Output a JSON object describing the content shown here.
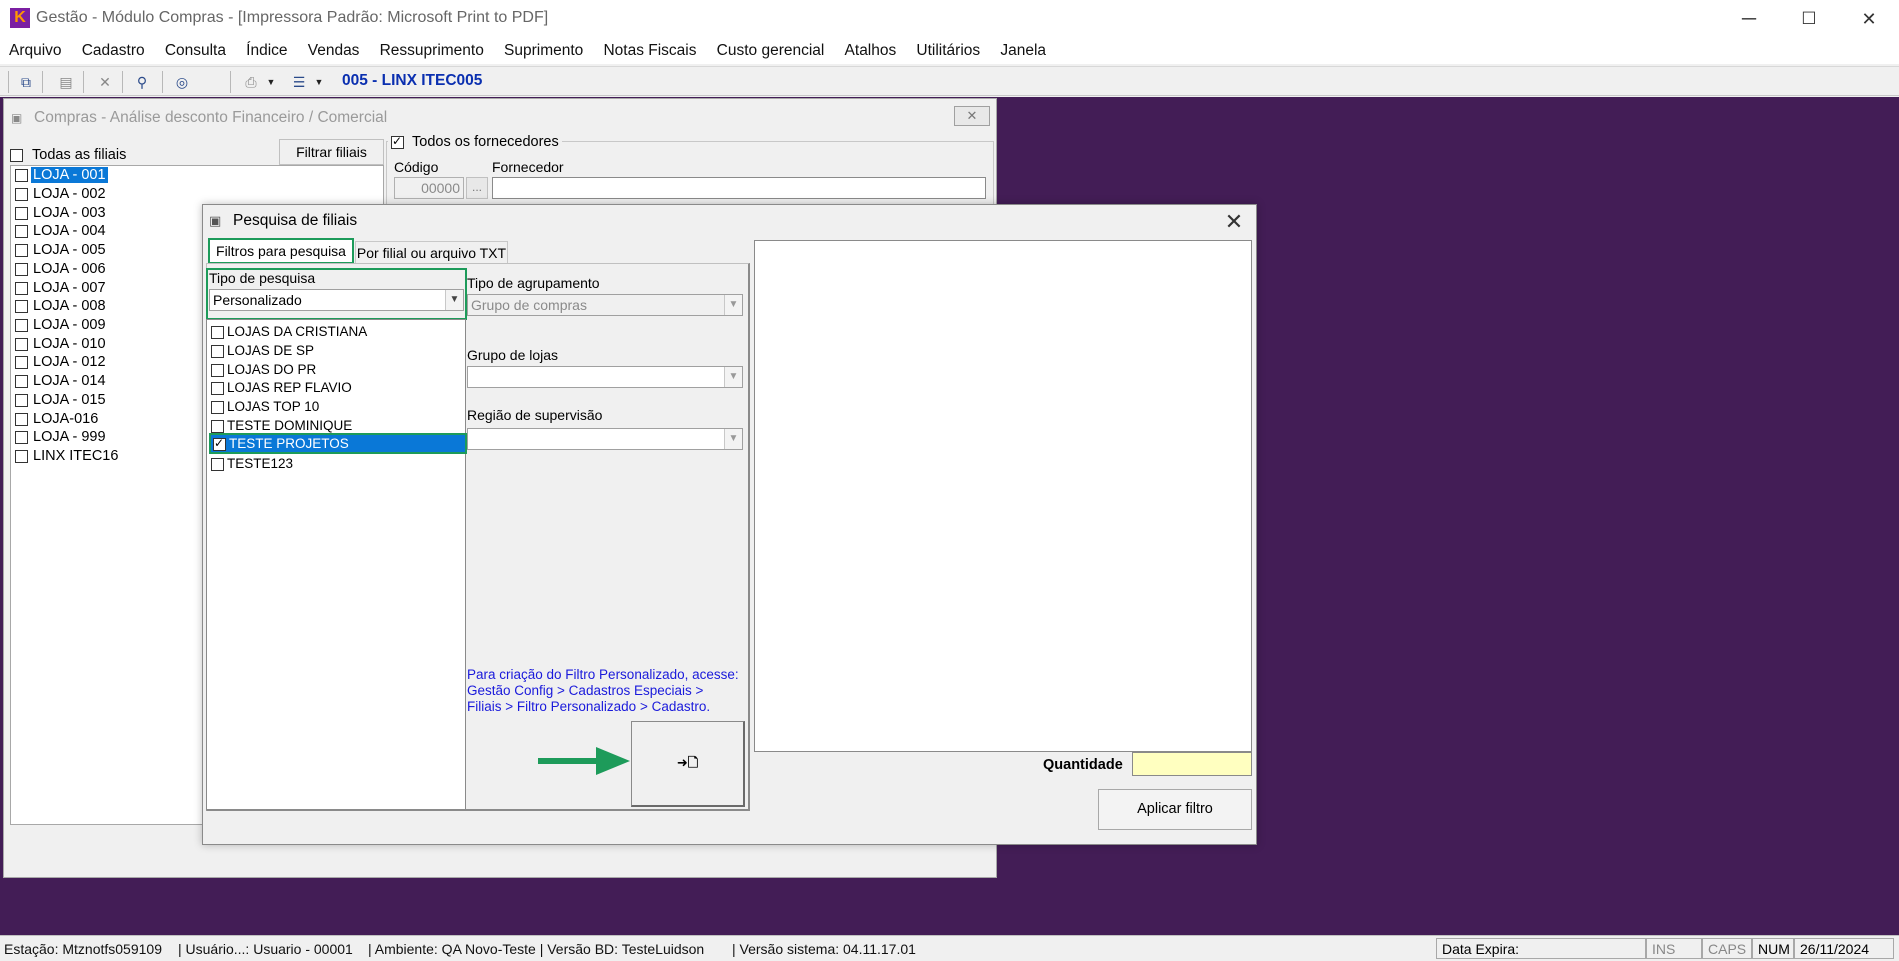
{
  "window": {
    "title": "Gestão  - Módulo Compras - [Impressora Padrão: Microsoft Print to PDF]",
    "minimize": "─",
    "maximize": "☐",
    "close": "✕"
  },
  "menu": [
    "Arquivo",
    "Cadastro",
    "Consulta",
    "Índice",
    "Vendas",
    "Ressuprimento",
    "Suprimento",
    "Notas Fiscais",
    "Custo gerencial",
    "Atalhos",
    "Utilitários",
    "Janela"
  ],
  "toolbar": {
    "store_label": "005 - LINX ITEC005",
    "icons": [
      "copy-icon",
      "paste-icon",
      "delete-icon",
      "search-icon",
      "target-icon",
      "print-icon",
      "dropdown-icon",
      "export-icon",
      "dropdown-icon"
    ]
  },
  "background_window": {
    "title": "Compras - Análise desconto Financeiro / Comercial",
    "close": "✕",
    "todas_filiais_label": "Todas as filiais",
    "filtrar_filiais_button": "Filtrar filiais",
    "todos_fornecedores_label": "Todos os fornecedores",
    "codigo_label": "Código",
    "codigo_value": "00000",
    "fornecedor_label": "Fornecedor",
    "lookup_button": "...",
    "filiais": [
      {
        "label": "LOJA - 001",
        "selected": true
      },
      {
        "label": "LOJA - 002",
        "selected": false
      },
      {
        "label": "LOJA - 003",
        "selected": false
      },
      {
        "label": "LOJA - 004",
        "selected": false
      },
      {
        "label": "LOJA - 005",
        "selected": false
      },
      {
        "label": "LOJA - 006",
        "selected": false
      },
      {
        "label": "LOJA - 007",
        "selected": false
      },
      {
        "label": "LOJA - 008",
        "selected": false
      },
      {
        "label": "LOJA - 009",
        "selected": false
      },
      {
        "label": "LOJA - 010",
        "selected": false
      },
      {
        "label": "LOJA - 012",
        "selected": false
      },
      {
        "label": "LOJA - 014",
        "selected": false
      },
      {
        "label": "LOJA - 015",
        "selected": false
      },
      {
        "label": "LOJA-016",
        "selected": false
      },
      {
        "label": "LOJA - 999",
        "selected": false
      },
      {
        "label": "LINX ITEC16",
        "selected": false
      }
    ]
  },
  "dialog": {
    "title": "Pesquisa de filiais",
    "close": "✕",
    "tabs": [
      {
        "label": "Filtros para pesquisa",
        "active": true
      },
      {
        "label": "Por filial ou arquivo TXT",
        "active": false
      }
    ],
    "tipo_pesquisa_label": "Tipo de pesquisa",
    "tipo_pesquisa_value": "Personalizado",
    "tipo_agrupamento_label": "Tipo de agrupamento",
    "tipo_agrupamento_value": "Grupo de compras",
    "grupo_lojas_label": "Grupo de lojas",
    "grupo_lojas_value": "",
    "regiao_label": "Região de supervisão",
    "regiao_value": "",
    "items": [
      {
        "label": "LOJAS DA CRISTIANA",
        "checked": false,
        "selected": false
      },
      {
        "label": "LOJAS DE SP",
        "checked": false,
        "selected": false
      },
      {
        "label": "LOJAS DO PR",
        "checked": false,
        "selected": false
      },
      {
        "label": "LOJAS REP FLAVIO",
        "checked": false,
        "selected": false
      },
      {
        "label": "LOJAS TOP 10",
        "checked": false,
        "selected": false
      },
      {
        "label": "TESTE DOMINIQUE",
        "checked": false,
        "selected": false
      },
      {
        "label": "TESTE PROJETOS",
        "checked": true,
        "selected": true
      },
      {
        "label": "TESTE123",
        "checked": false,
        "selected": false
      }
    ],
    "help_text_1": "Para criação do Filtro Personalizado, acesse:",
    "help_text_2": "Gestão Config > Cadastros Especiais >",
    "help_text_3": "Filiais > Filtro Personalizado > Cadastro.",
    "add_button_glyph": "➜🗋",
    "quantidade_label": "Quantidade",
    "quantidade_value": "",
    "aplicar_button": "Aplicar filtro"
  },
  "statusbar": {
    "estacao": "Estação: Mtznotfs059109",
    "usuario": "| Usuário...: Usuario - 00001",
    "ambiente": "| Ambiente: QA Novo-Teste | Versão BD: TesteLuidson",
    "versao": "| Versão sistema: 04.11.17.01",
    "data_expira": "Data Expira:",
    "ins": "INS",
    "caps": "CAPS",
    "num": "NUM",
    "date": "26/11/2024"
  },
  "colors": {
    "mdi_background": "#431d56",
    "selection": "#0a78d7",
    "highlight_box": "#1d9b5a",
    "arrow": "#1d9b5a",
    "help_text": "#1a1adb",
    "quantidade_field": "#ffffc0"
  }
}
